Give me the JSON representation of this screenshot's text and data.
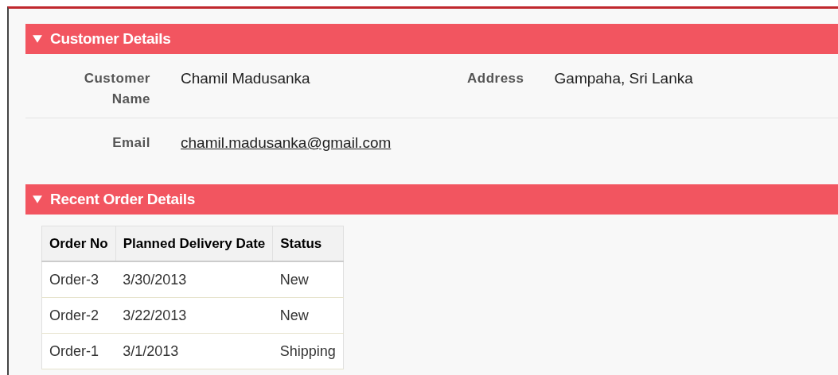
{
  "sections": [
    {
      "title": "Customer Details",
      "expanded": true
    },
    {
      "title": "Recent Order Details",
      "expanded": true
    }
  ],
  "customer": {
    "rows": [
      {
        "fields": [
          {
            "label": "Customer Name",
            "value": "Chamil Madusanka",
            "kind": "text"
          },
          {
            "label": "Address",
            "value": "Gampaha, Sri Lanka",
            "kind": "text"
          }
        ]
      },
      {
        "fields": [
          {
            "label": "Email",
            "value": "chamil.madusanka@gmail.com",
            "kind": "link"
          }
        ]
      }
    ]
  },
  "orders": {
    "columns": [
      "Order No",
      "Planned Delivery Date",
      "Status"
    ],
    "rows": [
      [
        "Order-3",
        "3/30/2013",
        "New"
      ],
      [
        "Order-2",
        "3/22/2013",
        "New"
      ],
      [
        "Order-1",
        "3/1/2013",
        "Shipping"
      ]
    ]
  }
}
